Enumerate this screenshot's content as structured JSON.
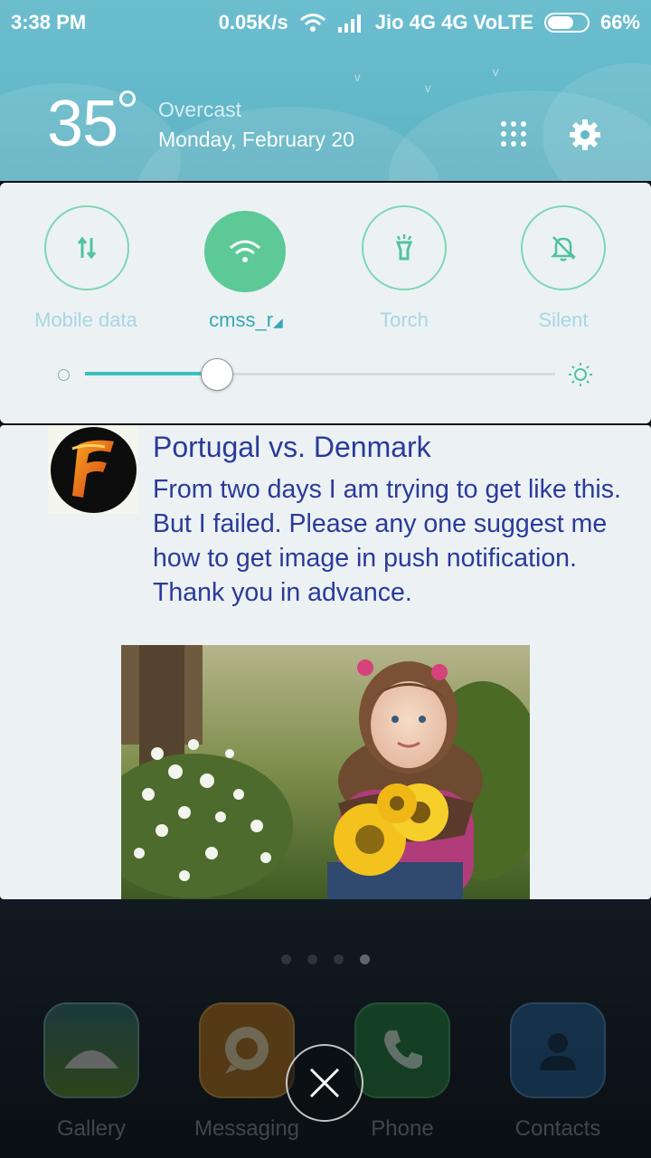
{
  "status_bar": {
    "time": "3:38 PM",
    "speed": "0.05K/s",
    "carrier": "Jio 4G 4G VoLTE",
    "battery": "66%",
    "battery_level": 0.66
  },
  "weather": {
    "temperature": "35",
    "condition": "Overcast",
    "date": "Monday, February 20"
  },
  "quick_settings": {
    "toggles": [
      {
        "label": "Mobile data",
        "icon": "mobile-data-icon",
        "active": false
      },
      {
        "label": "cmss_r",
        "icon": "wifi-icon",
        "active": true
      },
      {
        "label": "Torch",
        "icon": "torch-icon",
        "active": false
      },
      {
        "label": "Silent",
        "icon": "silent-bell-icon",
        "active": false
      }
    ],
    "brightness": 0.28
  },
  "notification": {
    "app_icon": "f-logo-icon",
    "title": "Portugal vs. Denmark",
    "body": "From two days I am trying to get like this. But I failed. Please any one suggest me how to get image in push notification. Thank you in advance.",
    "image": "girl-with-sunflowers-photo"
  },
  "home": {
    "pages": 4,
    "current_page": 4,
    "dock": [
      {
        "label": "Gallery",
        "icon": "gallery-icon"
      },
      {
        "label": "Messaging",
        "icon": "messaging-icon"
      },
      {
        "label": "Phone",
        "icon": "phone-icon"
      },
      {
        "label": "Contacts",
        "icon": "contacts-icon"
      }
    ]
  },
  "colors": {
    "header_bg": "#63b8c9",
    "panel_bg": "#ecf2f4",
    "accent_green": "#5cc997",
    "accent_teal": "#3cc0bd",
    "notif_text": "#2b3a9a"
  }
}
